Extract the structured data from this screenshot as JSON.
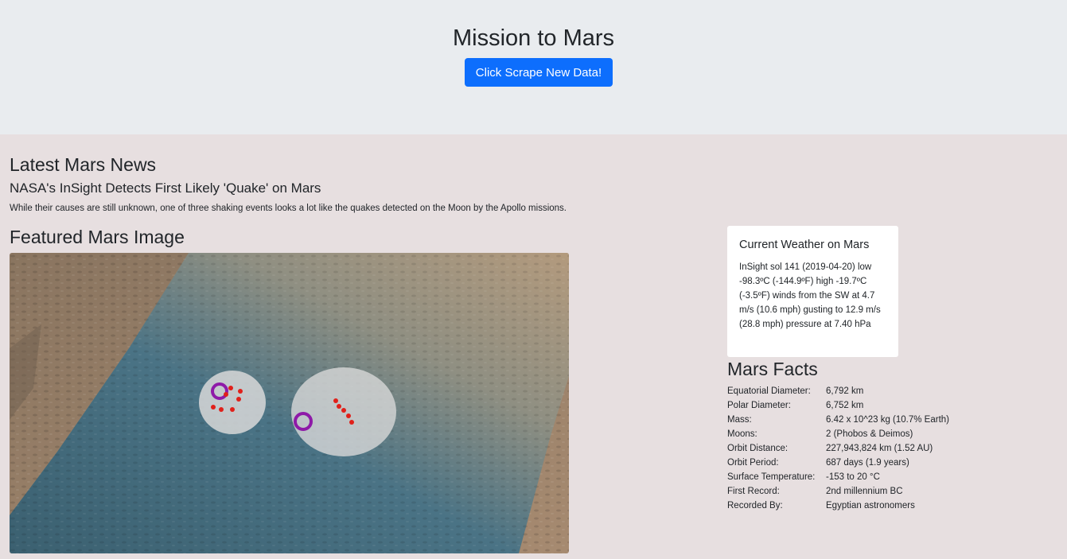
{
  "header": {
    "title": "Mission to Mars",
    "scrape_button": "Click Scrape New Data!"
  },
  "news": {
    "heading": "Latest Mars News",
    "title": "NASA's InSight Detects First Likely 'Quake' on Mars",
    "teaser": "While their causes are still unknown, one of three shaking events looks a lot like the quakes detected on the Moon by the Apollo missions."
  },
  "featured": {
    "heading": "Featured Mars Image"
  },
  "weather": {
    "heading": "Current Weather on Mars",
    "text": "InSight sol 141 (2019-04-20) low -98.3ºC (-144.9ºF) high -19.7ºC (-3.5ºF) winds from the SW at 4.7 m/s (10.6 mph) gusting to 12.9 m/s (28.8 mph) pressure at 7.40 hPa"
  },
  "facts": {
    "heading": "Mars Facts",
    "rows": [
      {
        "label": "Equatorial Diameter:",
        "value": "6,792 km"
      },
      {
        "label": "Polar Diameter:",
        "value": "6,752 km"
      },
      {
        "label": "Mass:",
        "value": "6.42 x 10^23 kg (10.7% Earth)"
      },
      {
        "label": "Moons:",
        "value": "2 (Phobos & Deimos)"
      },
      {
        "label": "Orbit Distance:",
        "value": "227,943,824 km (1.52 AU)"
      },
      {
        "label": "Orbit Period:",
        "value": "687 days (1.9 years)"
      },
      {
        "label": "Surface Temperature:",
        "value": "-153 to 20 °C"
      },
      {
        "label": "First Record:",
        "value": "2nd millennium BC"
      },
      {
        "label": "Recorded By:",
        "value": "Egyptian astronomers"
      }
    ]
  },
  "colors": {
    "button": "#0d6efd",
    "header_bg": "#e9ecef",
    "page_bg": "#e7dfe0"
  }
}
